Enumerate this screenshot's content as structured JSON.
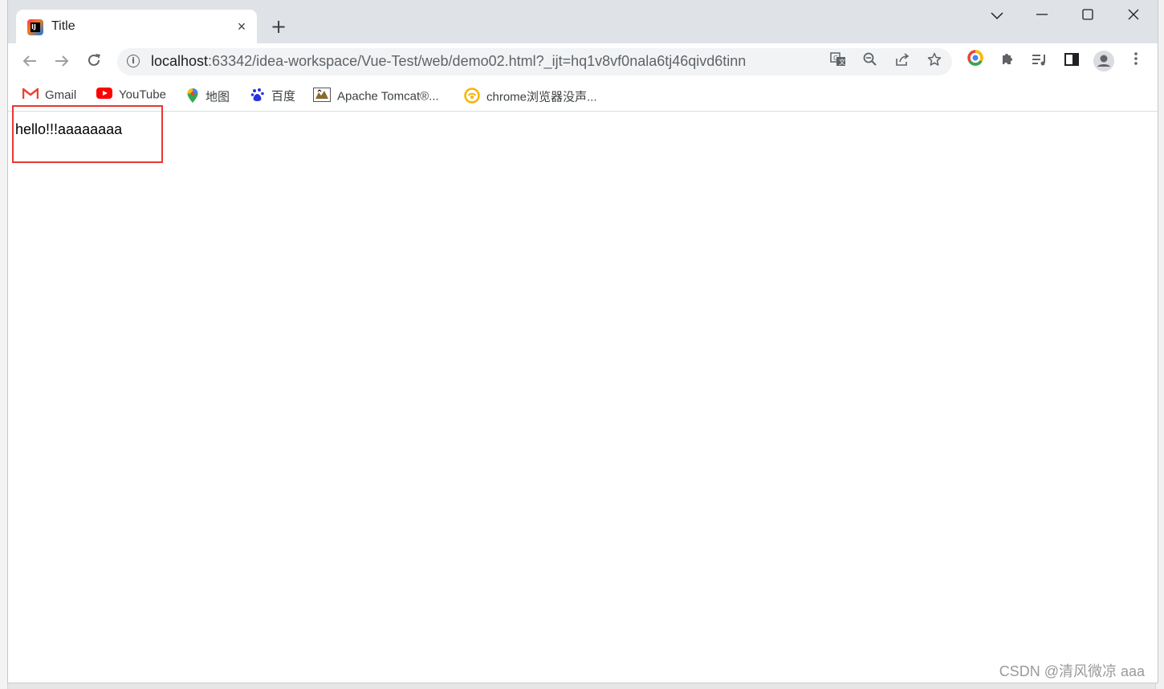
{
  "tab": {
    "title": "Title",
    "favicon": "jetbrains-icon",
    "close": "×"
  },
  "new_tab": "+",
  "window_controls": {
    "tab_search": "⌄",
    "minimize": "—",
    "maximize": "☐",
    "close": "✕"
  },
  "toolbar": {
    "back": "←",
    "forward": "→",
    "reload": "↻"
  },
  "omnibox": {
    "host": "localhost",
    "rest": ":63342/idea-workspace/Vue-Test/web/demo02.html?_ijt=hq1v8vf0nala6tj46qivd6tinn",
    "info": "i"
  },
  "omnibox_icons": {
    "translate": "G",
    "zoom": "⊖",
    "share": "⇪",
    "bookmark": "☆"
  },
  "toolbar_icons": {
    "chrome_ext": "◎",
    "extensions": "✚",
    "media": "♫",
    "side_panel": "▮",
    "profile": "●",
    "menu": "⋮"
  },
  "bookmarks": [
    {
      "label": "Gmail",
      "icon": "gmail-icon"
    },
    {
      "label": "YouTube",
      "icon": "youtube-icon"
    },
    {
      "label": "地图",
      "icon": "maps-pin-icon"
    },
    {
      "label": "百度",
      "icon": "baidu-paw-icon"
    },
    {
      "label": "Apache Tomcat®...",
      "icon": "tomcat-icon"
    },
    {
      "label": "chrome浏览器没声...",
      "icon": "chrome-audio-icon"
    }
  ],
  "page": {
    "text": "hello!!!aaaaaaaa"
  },
  "watermark": "CSDN @清风微凉 aaa",
  "colors": {
    "highlight": "#e53935",
    "titlebar": "#dfe3e8",
    "omnibox": "#f1f3f4"
  }
}
